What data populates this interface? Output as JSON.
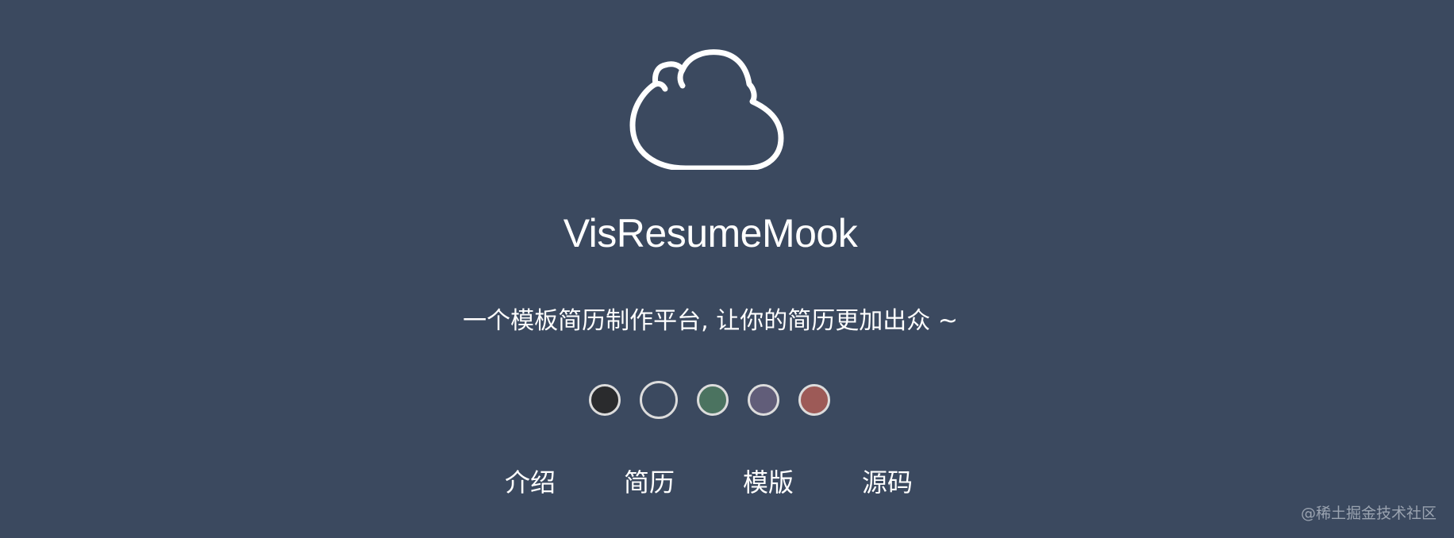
{
  "app": {
    "title": "VisResumeMook",
    "subtitle": "一个模板简历制作平台, 让你的简历更加出众 ~"
  },
  "colors": {
    "background": "#3b495f",
    "foreground": "#ffffff",
    "ring": "#dcdcdc"
  },
  "logo": {
    "icon": "cloud-icon"
  },
  "theme_swatches": [
    {
      "name": "black",
      "color": "#2a2b2d",
      "selected": false
    },
    {
      "name": "navy",
      "color": "#3b495f",
      "selected": true
    },
    {
      "name": "green",
      "color": "#4b7360",
      "selected": false
    },
    {
      "name": "purple",
      "color": "#615d79",
      "selected": false
    },
    {
      "name": "red",
      "color": "#9d5a57",
      "selected": false
    }
  ],
  "nav": {
    "items": [
      {
        "label": "介绍"
      },
      {
        "label": "简历"
      },
      {
        "label": "模版"
      },
      {
        "label": "源码"
      }
    ]
  },
  "watermark": "@稀土掘金技术社区"
}
